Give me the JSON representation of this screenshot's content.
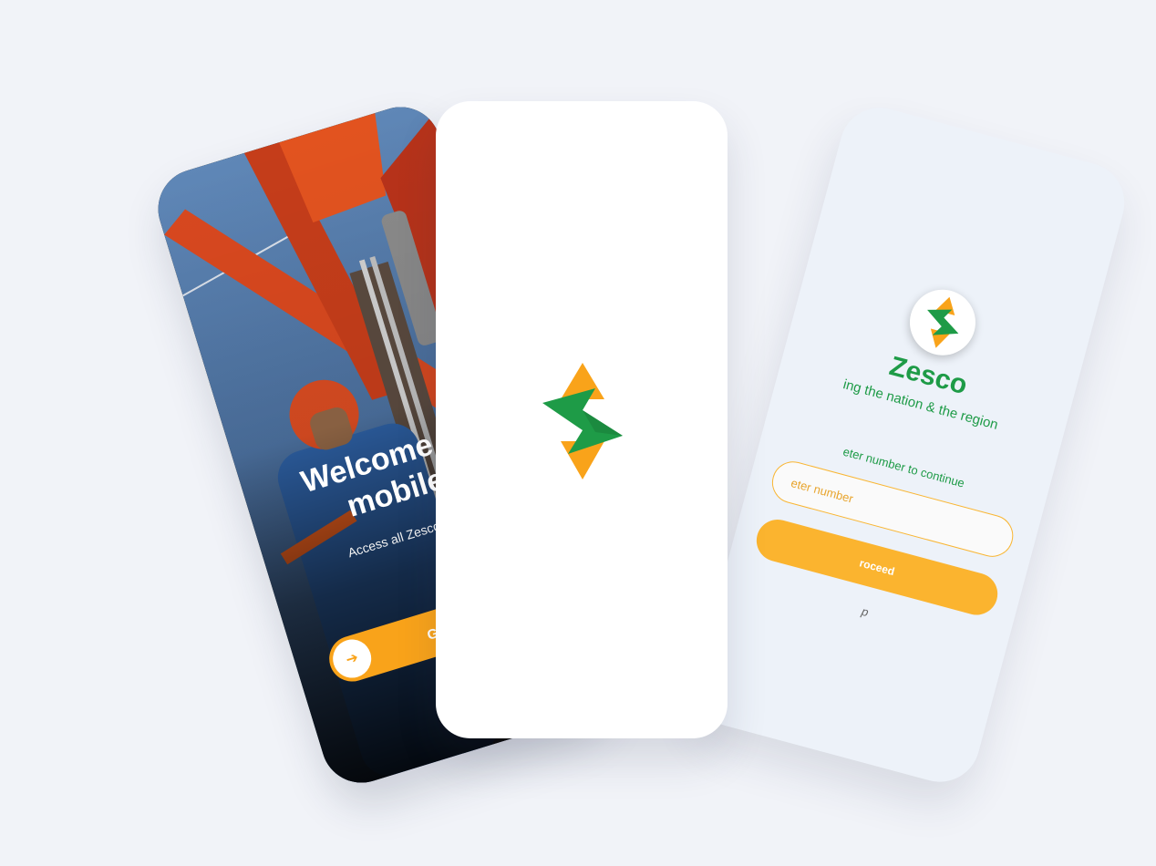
{
  "brand": {
    "colors": {
      "green": "#1e9b47",
      "orange": "#f9a31a",
      "orange_light": "#fbb42f",
      "background": "#f1f3f8"
    },
    "logo_icon": "zesco-lightning-logo"
  },
  "welcome_screen": {
    "title_line1": "Welcome to",
    "title_line2": "mobile",
    "subtitle": "Access all Zesco servi",
    "cta_label": "Get",
    "cta_icon": "arrow-right-icon"
  },
  "splash_screen": {
    "logo_icon": "zesco-lightning-logo"
  },
  "login_screen": {
    "brand_name": "Zesco",
    "tagline": "ing the nation & the region",
    "prompt": "eter number to continue",
    "meter_placeholder": "eter number",
    "proceed_label": "roceed",
    "help_text": "p"
  }
}
